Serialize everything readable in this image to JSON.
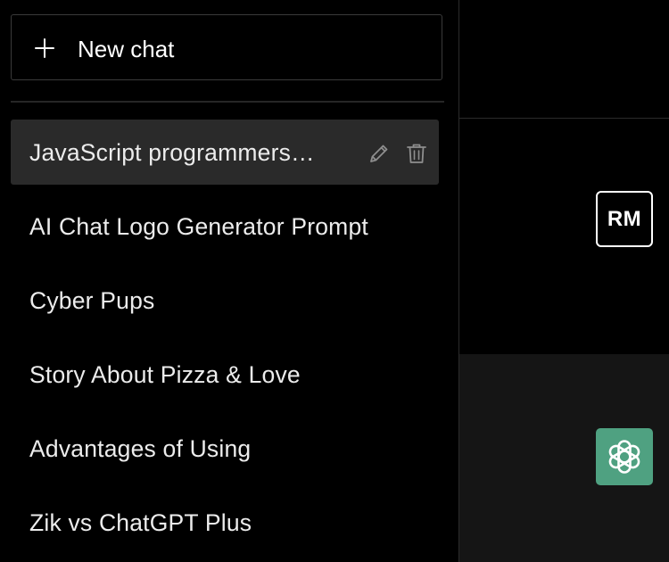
{
  "sidebar": {
    "new_chat_label": "New chat",
    "chats": [
      {
        "title": "JavaScript programmers…",
        "active": true
      },
      {
        "title": "AI Chat Logo Generator Prompt",
        "active": false
      },
      {
        "title": "Cyber Pups",
        "active": false
      },
      {
        "title": "Story About Pizza & Love",
        "active": false
      },
      {
        "title": "Advantages of Using",
        "active": false
      },
      {
        "title": "Zik vs ChatGPT Plus",
        "active": false
      }
    ],
    "icons": {
      "new_chat": "plus-icon",
      "edit": "pencil-icon",
      "delete": "trash-icon"
    }
  },
  "conversation": {
    "user_avatar_initials": "RM",
    "bot_avatar_icon": "openai-logo-icon",
    "colors": {
      "bot_avatar_bg": "#4fa181",
      "active_chat_bg": "#2a2a2a"
    }
  }
}
